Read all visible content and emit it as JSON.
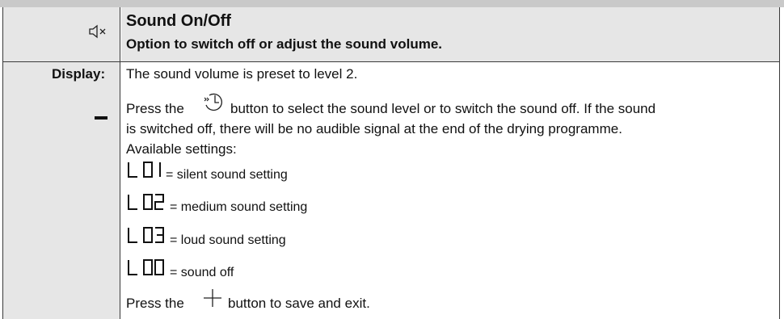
{
  "header": {
    "title": "Sound On/Off",
    "subtitle": "Option to switch off or adjust the sound volume.",
    "icon": "speaker-muted-icon"
  },
  "row": {
    "label": "Display:",
    "display_icon": "dash-segment-icon",
    "preset_text": "The sound volume is preset to level 2.",
    "press_prefix": "Press the",
    "press_icon": "delay-timer-icon",
    "press_suffix_line1": "button to select the sound level or to switch the sound off. If the sound",
    "press_line2": "is switched off, there will be no audible signal at the end of the drying programme.",
    "available": "Available settings:",
    "settings": [
      {
        "code": "L 01",
        "text": "= silent sound setting"
      },
      {
        "code": "L 02",
        "text": "= medium sound setting"
      },
      {
        "code": "L 03",
        "text": "= loud sound setting"
      },
      {
        "code": "L 00",
        "text": "= sound off"
      }
    ],
    "save_prefix": "Press the",
    "save_icon": "plus-icon",
    "save_suffix": "button to save and exit."
  }
}
